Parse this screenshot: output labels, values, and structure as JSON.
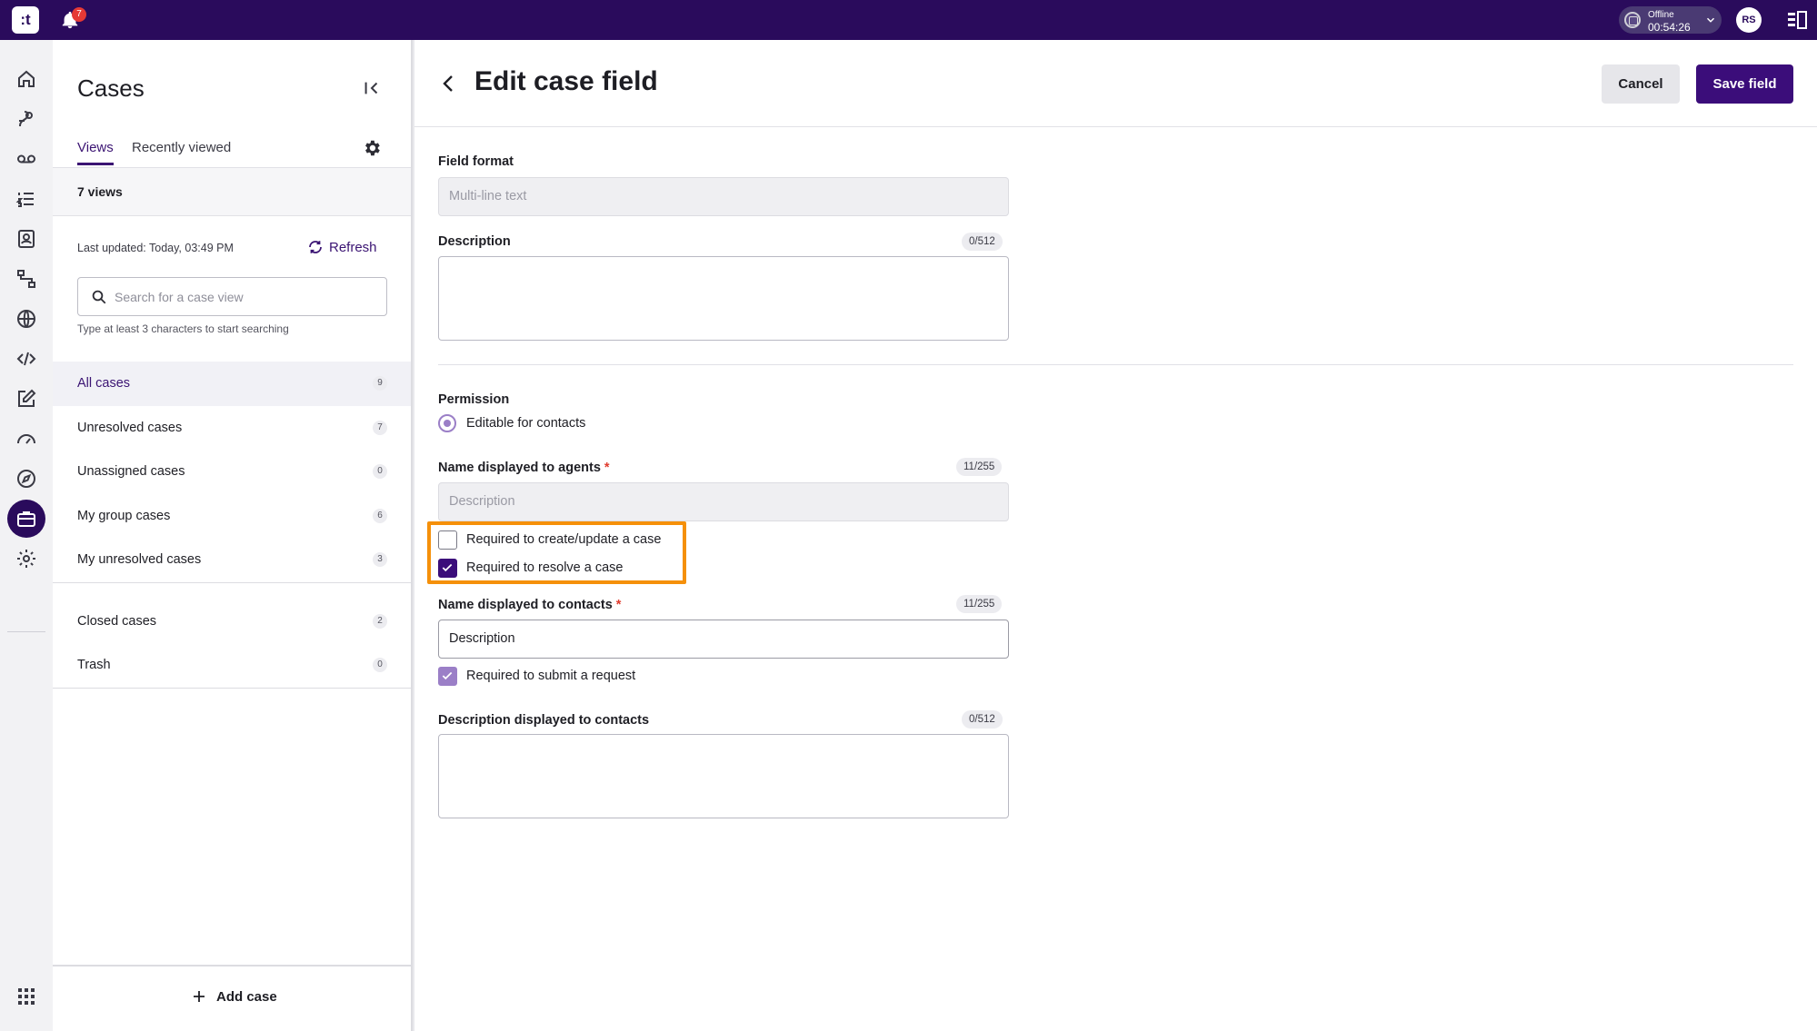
{
  "topbar": {
    "logo_text": ":t",
    "notifications_count": "7",
    "status_label": "Offline",
    "status_timer": "00:54:26",
    "avatar_initials": "RS"
  },
  "rail": {
    "icons": [
      "home-icon",
      "routing-icon",
      "voicemail-icon",
      "list-icon",
      "contacts-icon",
      "flows-icon",
      "globe-icon",
      "code-icon",
      "edit-icon",
      "dashboard-icon",
      "compass-icon",
      "cases-icon",
      "settings-icon",
      "apps-grid-icon"
    ],
    "active": "cases-icon"
  },
  "cases_panel": {
    "title": "Cases",
    "tabs": [
      {
        "label": "Views",
        "active": true
      },
      {
        "label": "Recently viewed",
        "active": false
      }
    ],
    "views_count": "7 views",
    "last_updated": "Last updated:  Today, 03:49 PM",
    "refresh_label": "Refresh",
    "search": {
      "placeholder": "Search for a case view",
      "hint": "Type at least 3 characters to start searching"
    },
    "views": [
      {
        "label": "All cases",
        "count": "9",
        "active": true
      },
      {
        "label": "Unresolved cases",
        "count": "7"
      },
      {
        "label": "Unassigned cases",
        "count": "0"
      },
      {
        "label": "My group cases",
        "count": "6"
      },
      {
        "label": "My unresolved cases",
        "count": "3"
      }
    ],
    "other_views": [
      {
        "label": "Closed cases",
        "count": "2"
      },
      {
        "label": "Trash",
        "count": "0"
      }
    ],
    "add_case_label": "Add case"
  },
  "editor": {
    "title": "Edit case field",
    "cancel_label": "Cancel",
    "save_label": "Save field",
    "field_format": {
      "label": "Field format",
      "value": "Multi-line text"
    },
    "description": {
      "label": "Description",
      "counter": "0/512",
      "value": ""
    },
    "permission": {
      "label": "Permission",
      "option": "Editable for contacts"
    },
    "agent_name": {
      "label": "Name displayed to agents",
      "required_mark": "*",
      "counter": "11/255",
      "placeholder": "Description"
    },
    "agent_checkboxes": [
      {
        "label": "Required to create/update a case",
        "checked": false
      },
      {
        "label": "Required to resolve a case",
        "checked": true
      }
    ],
    "contact_name": {
      "label": "Name displayed to contacts",
      "required_mark": "*",
      "counter": "11/255",
      "value": "Description"
    },
    "contact_checkbox": {
      "label": "Required to submit a request",
      "checked": true
    },
    "contact_description": {
      "label": "Description displayed to contacts",
      "counter": "0/512",
      "value": ""
    }
  },
  "colors": {
    "brand": "#2a0b5c",
    "accent": "#3b0d7a",
    "highlight": "#f5900a",
    "required": "#e03c2f"
  }
}
